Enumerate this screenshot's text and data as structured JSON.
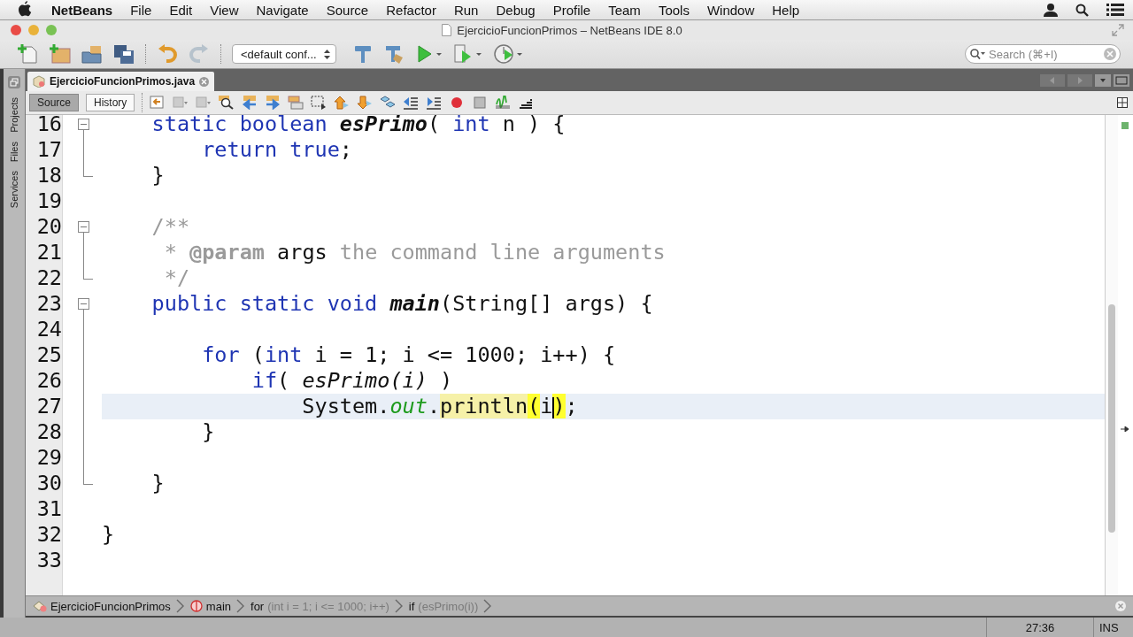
{
  "menu_bar": {
    "app": "NetBeans",
    "items": [
      "File",
      "Edit",
      "View",
      "Navigate",
      "Source",
      "Refactor",
      "Run",
      "Debug",
      "Profile",
      "Team",
      "Tools",
      "Window",
      "Help"
    ]
  },
  "window": {
    "title": "EjercicioFuncionPrimos – NetBeans IDE 8.0"
  },
  "toolbar": {
    "configuration": "<default conf...",
    "search": {
      "placeholder": "Search (⌘+I)"
    }
  },
  "side_tabs": [
    "Projects",
    "Files",
    "Services"
  ],
  "editor_tabs": [
    {
      "label": "EjercicioFuncionPrimos.java",
      "selected": true
    }
  ],
  "view_tabs": [
    {
      "label": "Source",
      "selected": true
    },
    {
      "label": "History",
      "selected": false
    }
  ],
  "lines": [
    {
      "number": "16",
      "current": false,
      "kind": "opener",
      "tokens": [
        {
          "kind": "kw",
          "text": "    static boolean "
        },
        {
          "kind": "decl",
          "text": "esPrimo"
        },
        {
          "kind": "plain",
          "text": "( "
        },
        {
          "kind": "kw",
          "text": "int"
        },
        {
          "kind": "plain",
          "text": " n ) {"
        }
      ]
    },
    {
      "number": "17",
      "current": false,
      "kind": "inner",
      "tokens": [
        {
          "kind": "kw",
          "text": "        return true"
        },
        {
          "kind": "plain",
          "text": ";"
        }
      ]
    },
    {
      "number": "18",
      "current": false,
      "kind": "closer",
      "tokens": [
        {
          "kind": "plain",
          "text": "    }"
        }
      ]
    },
    {
      "number": "19",
      "current": false,
      "kind": "line"
    },
    {
      "number": "20",
      "current": false,
      "kind": "opener",
      "tokens": [
        {
          "kind": "comment",
          "text": "    /**"
        }
      ]
    },
    {
      "number": "21",
      "current": false,
      "kind": "inner",
      "tokens": [
        {
          "kind": "comment",
          "text": "     * "
        },
        {
          "kind": "doctag",
          "text": "@param"
        },
        {
          "kind": "plain",
          "text": " args"
        },
        {
          "kind": "comment",
          "text": " the command line arguments"
        }
      ]
    },
    {
      "number": "22",
      "current": false,
      "kind": "closer",
      "tokens": [
        {
          "kind": "comment",
          "text": "     */"
        }
      ]
    },
    {
      "number": "23",
      "current": false,
      "kind": "opener",
      "tokens": [
        {
          "kind": "kw",
          "text": "    public static void "
        },
        {
          "kind": "decl",
          "text": "main"
        },
        {
          "kind": "plain",
          "text": "(String[] args) {"
        }
      ]
    },
    {
      "number": "24",
      "current": false,
      "kind": "inner"
    },
    {
      "number": "25",
      "current": false,
      "kind": "inner",
      "tokens": [
        {
          "kind": "kw",
          "text": "        for"
        },
        {
          "kind": "plain",
          "text": " ("
        },
        {
          "kind": "kw",
          "text": "int"
        },
        {
          "kind": "plain",
          "text": " i = 1; i <= 1000; i++) {"
        }
      ]
    },
    {
      "number": "26",
      "current": false,
      "kind": "inner",
      "tokens": [
        {
          "kind": "kw",
          "text": "            if"
        },
        {
          "kind": "plain",
          "text": "( "
        },
        {
          "kind": "call",
          "text": "esPrimo(i)"
        },
        {
          "kind": "plain",
          "text": " )"
        }
      ]
    },
    {
      "number": "27",
      "current": true,
      "kind": "inner",
      "tokens": [
        {
          "kind": "plain",
          "text": "                System."
        },
        {
          "kind": "field",
          "text": "out"
        },
        {
          "kind": "plain",
          "text": "."
        },
        {
          "kind": "mark",
          "text": "println"
        },
        {
          "kind": "match",
          "text": "("
        },
        {
          "kind": "plain",
          "text": "i"
        },
        {
          "kind": "caret-match",
          "text": ")"
        },
        {
          "kind": "plain",
          "text": ";"
        }
      ]
    },
    {
      "number": "28",
      "current": false,
      "kind": "inner",
      "tokens": [
        {
          "kind": "plain",
          "text": "        }"
        }
      ]
    },
    {
      "number": "29",
      "current": false,
      "kind": "inner"
    },
    {
      "number": "30",
      "current": false,
      "kind": "closer",
      "tokens": [
        {
          "kind": "plain",
          "text": "    }"
        }
      ]
    },
    {
      "number": "31",
      "current": false,
      "kind": "line"
    },
    {
      "number": "32",
      "current": false,
      "kind": "line",
      "tokens": [
        {
          "kind": "plain",
          "text": "}"
        }
      ]
    },
    {
      "number": "33",
      "current": false,
      "kind": "line"
    }
  ],
  "breadcrumbs": [
    {
      "kind": "class",
      "label": "EjercicioFuncionPrimos"
    },
    {
      "kind": "method",
      "label": "main"
    },
    {
      "kind": "statement",
      "label": "for",
      "detail": "(int i = 1; i <= 1000; i++)"
    },
    {
      "kind": "statement",
      "label": "if",
      "detail": "(esPrimo(i))"
    }
  ],
  "status_bar": {
    "position": "27:36",
    "mode": "INS"
  }
}
